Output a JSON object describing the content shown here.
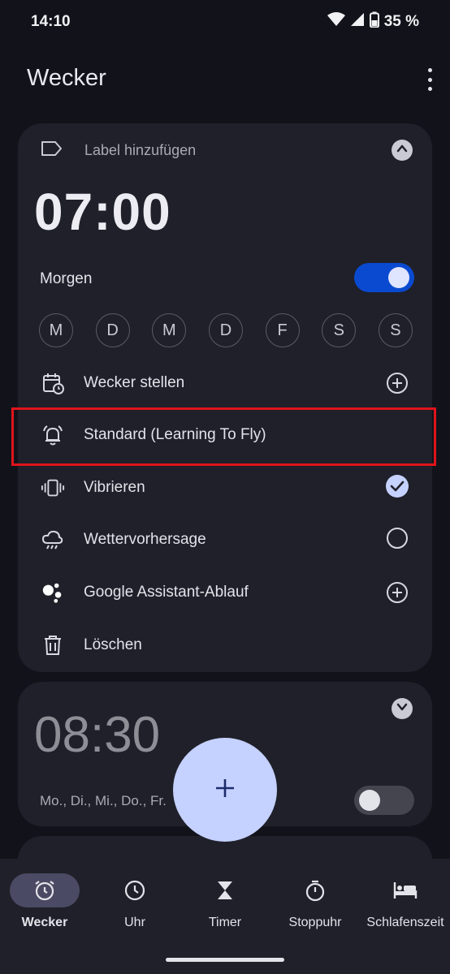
{
  "status": {
    "time": "14:10",
    "battery": "35 %"
  },
  "appbar": {
    "title": "Wecker"
  },
  "alarm1": {
    "label_placeholder": "Label hinzufügen",
    "time": "07:00",
    "name": "Morgen",
    "enabled": true,
    "days": [
      "M",
      "D",
      "M",
      "D",
      "F",
      "S",
      "S"
    ],
    "rows": {
      "schedule": "Wecker stellen",
      "sound": "Standard (Learning To Fly)",
      "vibrate": "Vibrieren",
      "weather": "Wettervorhersage",
      "assistant": "Google Assistant-Ablauf",
      "delete": "Löschen"
    },
    "vibrate_checked": true
  },
  "alarm2": {
    "time": "08:30",
    "days": "Mo., Di., Mi., Do., Fr.",
    "enabled": false
  },
  "fab": {
    "icon": "plus-icon"
  },
  "nav": {
    "items": [
      {
        "label": "Wecker",
        "icon": "alarm-icon"
      },
      {
        "label": "Uhr",
        "icon": "clock-icon"
      },
      {
        "label": "Timer",
        "icon": "hourglass-icon"
      },
      {
        "label": "Stoppuhr",
        "icon": "stopwatch-icon"
      },
      {
        "label": "Schlafenszeit",
        "icon": "bed-icon"
      }
    ]
  },
  "colors": {
    "accent": "#0a4ad1",
    "fab": "#c5d1ff",
    "highlight": "#e0141b",
    "background": "#12131a",
    "card": "#1f2029"
  }
}
